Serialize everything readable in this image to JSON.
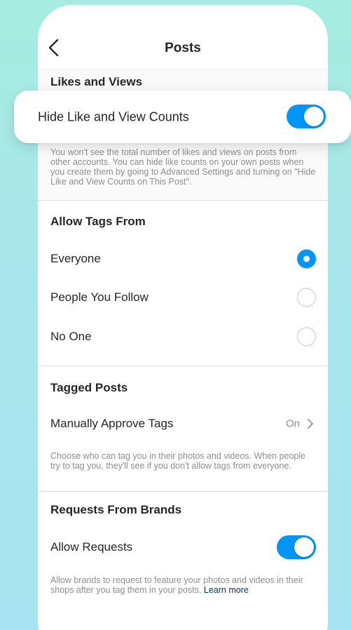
{
  "header": {
    "title": "Posts",
    "back_icon": "chevron-left-icon"
  },
  "likes_section": {
    "header": "Likes and Views",
    "toggle_label": "Hide Like and View Counts",
    "toggle_on": true,
    "description": "You won't see the total number of likes and views on posts from other accounts. You can hide like counts on your own posts when you create them by going to Advanced Settings and turning on \"Hide Like and View Counts on This Post\"."
  },
  "tags_section": {
    "header": "Allow Tags From",
    "options": [
      {
        "label": "Everyone",
        "selected": true
      },
      {
        "label": "People You Follow",
        "selected": false
      },
      {
        "label": "No One",
        "selected": false
      }
    ]
  },
  "tagged_posts_section": {
    "header": "Tagged Posts",
    "row_label": "Manually Approve Tags",
    "row_value": "On",
    "description": "Choose who can tag you in their photos and videos. When people try to tag you, they'll see if you don't allow tags from everyone."
  },
  "brands_section": {
    "header": "Requests From Brands",
    "toggle_label": "Allow Requests",
    "toggle_on": true,
    "description": "Allow brands to request to feature your photos and videos in their shops after you tag them in your posts.",
    "link_text": "Learn more"
  },
  "colors": {
    "accent": "#0095f6",
    "link": "#00376b",
    "background": "#a9e6ee"
  }
}
